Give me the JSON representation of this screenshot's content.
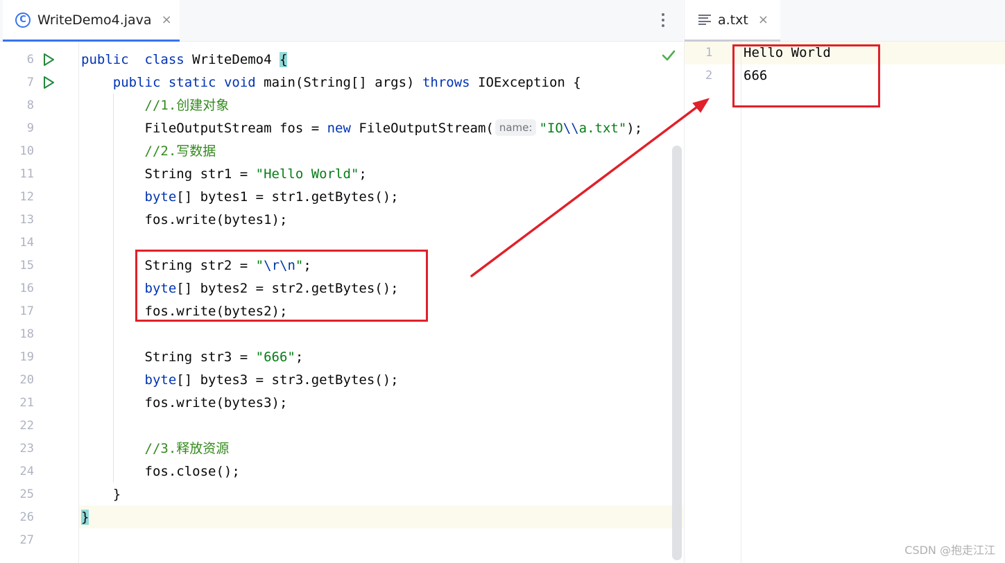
{
  "left_editor": {
    "tab": {
      "label": "WriteDemo4.java",
      "icon_name": "java-class-icon",
      "icon_glyph": "C",
      "close_glyph": "×"
    },
    "lines": [
      {
        "num": "6",
        "run": true,
        "tokens": [
          [
            "kw",
            "public"
          ],
          [
            "",
            "  "
          ],
          [
            "kw",
            "class"
          ],
          [
            "",
            " WriteDemo4 "
          ],
          [
            "brace",
            "{"
          ]
        ]
      },
      {
        "num": "7",
        "run": true,
        "tokens": [
          [
            "",
            "    "
          ],
          [
            "kw",
            "public"
          ],
          [
            "",
            " "
          ],
          [
            "kw",
            "static"
          ],
          [
            "",
            " "
          ],
          [
            "kw",
            "void"
          ],
          [
            "",
            " main(String[] args) "
          ],
          [
            "kw",
            "throws"
          ],
          [
            "",
            " IOException {"
          ]
        ]
      },
      {
        "num": "8",
        "tokens": [
          [
            "",
            "        "
          ],
          [
            "cmt",
            "//1.创建对象"
          ]
        ]
      },
      {
        "num": "9",
        "tokens": [
          [
            "",
            "        FileOutputStream fos = "
          ],
          [
            "kw",
            "new"
          ],
          [
            "",
            " FileOutputStream("
          ],
          [
            "hint",
            "name:"
          ],
          [
            "str",
            "\"IO"
          ],
          [
            "esc",
            "\\\\"
          ],
          [
            "str",
            "a.txt\""
          ],
          [
            "",
            ");"
          ]
        ]
      },
      {
        "num": "10",
        "tokens": [
          [
            "",
            "        "
          ],
          [
            "cmt",
            "//2.写数据"
          ]
        ]
      },
      {
        "num": "11",
        "tokens": [
          [
            "",
            "        String str1 = "
          ],
          [
            "str",
            "\"Hello World\""
          ],
          [
            "",
            ";"
          ]
        ]
      },
      {
        "num": "12",
        "tokens": [
          [
            "",
            "        "
          ],
          [
            "kw",
            "byte"
          ],
          [
            "",
            "[] bytes1 = str1.getBytes();"
          ]
        ]
      },
      {
        "num": "13",
        "tokens": [
          [
            "",
            "        fos.write(bytes1);"
          ]
        ]
      },
      {
        "num": "14",
        "tokens": []
      },
      {
        "num": "15",
        "tokens": [
          [
            "",
            "        String str2 = "
          ],
          [
            "str",
            "\""
          ],
          [
            "esc",
            "\\r\\n"
          ],
          [
            "str",
            "\""
          ],
          [
            "",
            ";"
          ]
        ]
      },
      {
        "num": "16",
        "tokens": [
          [
            "",
            "        "
          ],
          [
            "kw",
            "byte"
          ],
          [
            "",
            "[] bytes2 = str2.getBytes();"
          ]
        ]
      },
      {
        "num": "17",
        "tokens": [
          [
            "",
            "        fos.write(bytes2);"
          ]
        ]
      },
      {
        "num": "18",
        "tokens": []
      },
      {
        "num": "19",
        "tokens": [
          [
            "",
            "        String str3 = "
          ],
          [
            "str",
            "\"666\""
          ],
          [
            "",
            ";"
          ]
        ]
      },
      {
        "num": "20",
        "tokens": [
          [
            "",
            "        "
          ],
          [
            "kw",
            "byte"
          ],
          [
            "",
            "[] bytes3 = str3.getBytes();"
          ]
        ]
      },
      {
        "num": "21",
        "tokens": [
          [
            "",
            "        fos.write(bytes3);"
          ]
        ]
      },
      {
        "num": "22",
        "tokens": []
      },
      {
        "num": "23",
        "tokens": [
          [
            "",
            "        "
          ],
          [
            "cmt",
            "//3.释放资源"
          ]
        ]
      },
      {
        "num": "24",
        "tokens": [
          [
            "",
            "        fos.close();"
          ]
        ]
      },
      {
        "num": "25",
        "tokens": [
          [
            "",
            "    }"
          ]
        ]
      },
      {
        "num": "26",
        "tokens": [
          [
            "brace",
            "}"
          ]
        ]
      },
      {
        "num": "27",
        "tokens": []
      }
    ],
    "inspection_icon": "check-icon"
  },
  "right_editor": {
    "tab": {
      "label": "a.txt",
      "icon_name": "text-file-icon",
      "close_glyph": "×"
    },
    "lines": [
      {
        "num": "1",
        "text": "Hello World"
      },
      {
        "num": "2",
        "text": "666"
      }
    ]
  },
  "annotation": {
    "color": "#e0202a"
  },
  "colors": {
    "keyword": "#0033b3",
    "string": "#067d17",
    "comment": "#8c8c8c",
    "accent": "#3574f0"
  },
  "watermark": "CSDN @抱走江江"
}
